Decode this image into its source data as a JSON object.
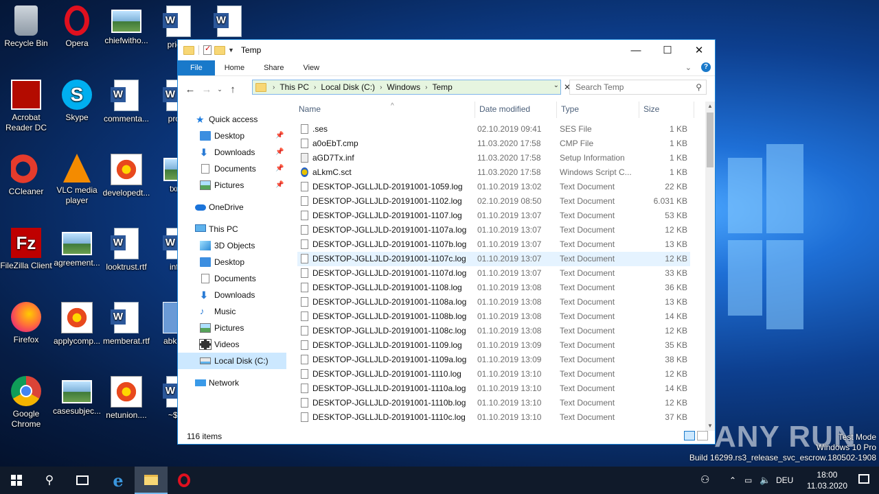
{
  "desktop": {
    "icons": [
      {
        "label": "Recycle Bin",
        "type": "bin"
      },
      {
        "label": "Opera",
        "type": "opera"
      },
      {
        "label": "chiefwitho...",
        "type": "img"
      },
      {
        "label": "priceh",
        "type": "word"
      },
      {
        "label": "",
        "type": "word"
      },
      {
        "label": "Acrobat Reader DC",
        "type": "acro"
      },
      {
        "label": "Skype",
        "type": "skype"
      },
      {
        "label": "commenta...",
        "type": "word"
      },
      {
        "label": "produ",
        "type": "word"
      },
      {
        "label": "CCleaner",
        "type": "ccl"
      },
      {
        "label": "VLC media player",
        "type": "vlc"
      },
      {
        "label": "developedt...",
        "type": "flower"
      },
      {
        "label": "txma",
        "type": "img"
      },
      {
        "label": "FileZilla Client",
        "type": "fz"
      },
      {
        "label": "agreement...",
        "type": "img"
      },
      {
        "label": "looktrust.rtf",
        "type": "word"
      },
      {
        "label": "info_",
        "type": "word"
      },
      {
        "label": "Firefox",
        "type": "ff"
      },
      {
        "label": "applycomp...",
        "type": "flower"
      },
      {
        "label": "memberat.rtf",
        "type": "word"
      },
      {
        "label": "abk Sho",
        "type": "gen"
      },
      {
        "label": "Google Chrome",
        "type": "chrome"
      },
      {
        "label": "casesubjec...",
        "type": "img"
      },
      {
        "label": "netunion....",
        "type": "flower"
      },
      {
        "label": "~$fo_",
        "type": "word"
      }
    ]
  },
  "explorer": {
    "title": "Temp",
    "ribbon_tabs": [
      "File",
      "Home",
      "Share",
      "View"
    ],
    "help": "?",
    "breadcrumb": [
      "This PC",
      "Local Disk (C:)",
      "Windows",
      "Temp"
    ],
    "search_placeholder": "Search Temp",
    "nav": {
      "quick_access": "Quick access",
      "quick_items": [
        "Desktop",
        "Downloads",
        "Documents",
        "Pictures"
      ],
      "onedrive": "OneDrive",
      "this_pc": "This PC",
      "pc_items": [
        "3D Objects",
        "Desktop",
        "Documents",
        "Downloads",
        "Music",
        "Pictures",
        "Videos",
        "Local Disk (C:)"
      ],
      "network": "Network",
      "selected": "Local Disk (C:)"
    },
    "columns": {
      "name": "Name",
      "date": "Date modified",
      "type": "Type",
      "size": "Size"
    },
    "files": [
      {
        "name": ".ses",
        "date": "02.10.2019 09:41",
        "type": "SES File",
        "size": "1 KB",
        "icon": "blank"
      },
      {
        "name": "a0oEbT.cmp",
        "date": "11.03.2020 17:58",
        "type": "CMP File",
        "size": "1 KB",
        "icon": "blank"
      },
      {
        "name": "aGD7Tx.inf",
        "date": "11.03.2020 17:58",
        "type": "Setup Information",
        "size": "1 KB",
        "icon": "inf"
      },
      {
        "name": "aLkmC.sct",
        "date": "11.03.2020 17:58",
        "type": "Windows Script C...",
        "size": "1 KB",
        "icon": "sct"
      },
      {
        "name": "DESKTOP-JGLLJLD-20191001-1059.log",
        "date": "01.10.2019 13:02",
        "type": "Text Document",
        "size": "22 KB",
        "icon": "txt"
      },
      {
        "name": "DESKTOP-JGLLJLD-20191001-1102.log",
        "date": "02.10.2019 08:50",
        "type": "Text Document",
        "size": "6.031 KB",
        "icon": "txt"
      },
      {
        "name": "DESKTOP-JGLLJLD-20191001-1107.log",
        "date": "01.10.2019 13:07",
        "type": "Text Document",
        "size": "53 KB",
        "icon": "txt"
      },
      {
        "name": "DESKTOP-JGLLJLD-20191001-1107a.log",
        "date": "01.10.2019 13:07",
        "type": "Text Document",
        "size": "12 KB",
        "icon": "txt"
      },
      {
        "name": "DESKTOP-JGLLJLD-20191001-1107b.log",
        "date": "01.10.2019 13:07",
        "type": "Text Document",
        "size": "13 KB",
        "icon": "txt"
      },
      {
        "name": "DESKTOP-JGLLJLD-20191001-1107c.log",
        "date": "01.10.2019 13:07",
        "type": "Text Document",
        "size": "12 KB",
        "icon": "txt",
        "hover": true
      },
      {
        "name": "DESKTOP-JGLLJLD-20191001-1107d.log",
        "date": "01.10.2019 13:07",
        "type": "Text Document",
        "size": "33 KB",
        "icon": "txt"
      },
      {
        "name": "DESKTOP-JGLLJLD-20191001-1108.log",
        "date": "01.10.2019 13:08",
        "type": "Text Document",
        "size": "36 KB",
        "icon": "txt"
      },
      {
        "name": "DESKTOP-JGLLJLD-20191001-1108a.log",
        "date": "01.10.2019 13:08",
        "type": "Text Document",
        "size": "13 KB",
        "icon": "txt"
      },
      {
        "name": "DESKTOP-JGLLJLD-20191001-1108b.log",
        "date": "01.10.2019 13:08",
        "type": "Text Document",
        "size": "14 KB",
        "icon": "txt"
      },
      {
        "name": "DESKTOP-JGLLJLD-20191001-1108c.log",
        "date": "01.10.2019 13:08",
        "type": "Text Document",
        "size": "12 KB",
        "icon": "txt"
      },
      {
        "name": "DESKTOP-JGLLJLD-20191001-1109.log",
        "date": "01.10.2019 13:09",
        "type": "Text Document",
        "size": "35 KB",
        "icon": "txt"
      },
      {
        "name": "DESKTOP-JGLLJLD-20191001-1109a.log",
        "date": "01.10.2019 13:09",
        "type": "Text Document",
        "size": "38 KB",
        "icon": "txt"
      },
      {
        "name": "DESKTOP-JGLLJLD-20191001-1110.log",
        "date": "01.10.2019 13:10",
        "type": "Text Document",
        "size": "12 KB",
        "icon": "txt"
      },
      {
        "name": "DESKTOP-JGLLJLD-20191001-1110a.log",
        "date": "01.10.2019 13:10",
        "type": "Text Document",
        "size": "14 KB",
        "icon": "txt"
      },
      {
        "name": "DESKTOP-JGLLJLD-20191001-1110b.log",
        "date": "01.10.2019 13:10",
        "type": "Text Document",
        "size": "12 KB",
        "icon": "txt"
      },
      {
        "name": "DESKTOP-JGLLJLD-20191001-1110c.log",
        "date": "01.10.2019 13:10",
        "type": "Text Document",
        "size": "37 KB",
        "icon": "txt"
      }
    ],
    "status": "116 items"
  },
  "overlay": {
    "watermark": "ANY RUN",
    "test_mode": "Test Mode",
    "os": "Windows 10 Pro",
    "build": "Build 16299.rs3_release_svc_escrow.180502-1908"
  },
  "taskbar": {
    "lang": "DEU",
    "time": "18:00",
    "date": "11.03.2020"
  },
  "colors": {
    "accent": "#1979ca",
    "selection": "#cce8ff",
    "hover_row": "#e5f3ff"
  }
}
